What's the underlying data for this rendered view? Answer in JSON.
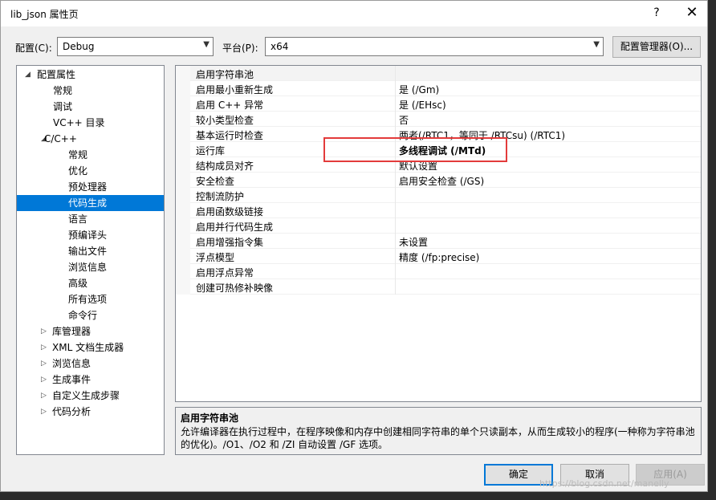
{
  "window": {
    "title": "lib_json 属性页",
    "help": "?",
    "close": "✕"
  },
  "config": {
    "config_label": "配置(C):",
    "config_value": "Debug",
    "platform_label": "平台(P):",
    "platform_value": "x64",
    "manager_button": "配置管理器(O)..."
  },
  "tree": [
    {
      "label": "配置属性",
      "expander": "◢"
    },
    {
      "label": "常规"
    },
    {
      "label": "调试"
    },
    {
      "label": "VC++ 目录"
    },
    {
      "label": "C/C++",
      "expander": "◢"
    },
    {
      "label": "常规"
    },
    {
      "label": "优化"
    },
    {
      "label": "预处理器"
    },
    {
      "label": "代码生成",
      "selected": true
    },
    {
      "label": "语言"
    },
    {
      "label": "预编译头"
    },
    {
      "label": "输出文件"
    },
    {
      "label": "浏览信息"
    },
    {
      "label": "高级"
    },
    {
      "label": "所有选项"
    },
    {
      "label": "命令行"
    },
    {
      "label": "库管理器",
      "expander": "▷"
    },
    {
      "label": "XML 文档生成器",
      "expander": "▷"
    },
    {
      "label": "浏览信息",
      "expander": "▷"
    },
    {
      "label": "生成事件",
      "expander": "▷"
    },
    {
      "label": "自定义生成步骤",
      "expander": "▷"
    },
    {
      "label": "代码分析",
      "expander": "▷"
    }
  ],
  "properties": [
    {
      "name": "启用字符串池",
      "value": ""
    },
    {
      "name": "启用最小重新生成",
      "value": "是 (/Gm)"
    },
    {
      "name": "启用 C++ 异常",
      "value": "是 (/EHsc)"
    },
    {
      "name": "较小类型检查",
      "value": "否"
    },
    {
      "name": "基本运行时检查",
      "value": "两者(/RTC1，等同于 /RTCsu) (/RTC1)"
    },
    {
      "name": "运行库",
      "value": "多线程调试 (/MTd)",
      "bold": true
    },
    {
      "name": "结构成员对齐",
      "value": "默认设置"
    },
    {
      "name": "安全检查",
      "value": "启用安全检查 (/GS)"
    },
    {
      "name": "控制流防护",
      "value": ""
    },
    {
      "name": "启用函数级链接",
      "value": ""
    },
    {
      "name": "启用并行代码生成",
      "value": ""
    },
    {
      "name": "启用增强指令集",
      "value": "未设置"
    },
    {
      "name": "浮点模型",
      "value": "精度 (/fp:precise)"
    },
    {
      "name": "启用浮点异常",
      "value": ""
    },
    {
      "name": "创建可热修补映像",
      "value": ""
    }
  ],
  "description": {
    "title": "启用字符串池",
    "text": "允许编译器在执行过程中，在程序映像和内存中创建相同字符串的单个只读副本，从而生成较小的程序(一种称为字符串池的优化)。/O1、/O2 和 /ZI 自动设置 /GF 选项。"
  },
  "buttons": {
    "ok": "确定",
    "cancel": "取消",
    "apply": "应用(A)"
  },
  "watermark": "https://blog.csdn.net/manelly"
}
